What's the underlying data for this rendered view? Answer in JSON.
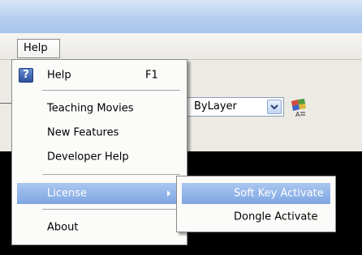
{
  "menubar": {
    "help_label": "Help"
  },
  "toolbar": {
    "layer_combo_value": "ByLayer"
  },
  "help_menu": {
    "items": [
      {
        "label": "Help",
        "shortcut": "F1",
        "icon": "help-question-icon"
      },
      {
        "label": "Teaching Movies"
      },
      {
        "label": "New Features"
      },
      {
        "label": "Developer Help"
      },
      {
        "label": "License",
        "has_submenu": true
      },
      {
        "label": "About"
      }
    ]
  },
  "license_submenu": {
    "items": [
      {
        "label": "Soft Key Activate"
      },
      {
        "label": "Dongle Activate"
      }
    ]
  },
  "colors": {
    "highlight": "#7ea5e2",
    "menu_bg": "#fbfbf9",
    "titlebar": "#b5cfef"
  }
}
